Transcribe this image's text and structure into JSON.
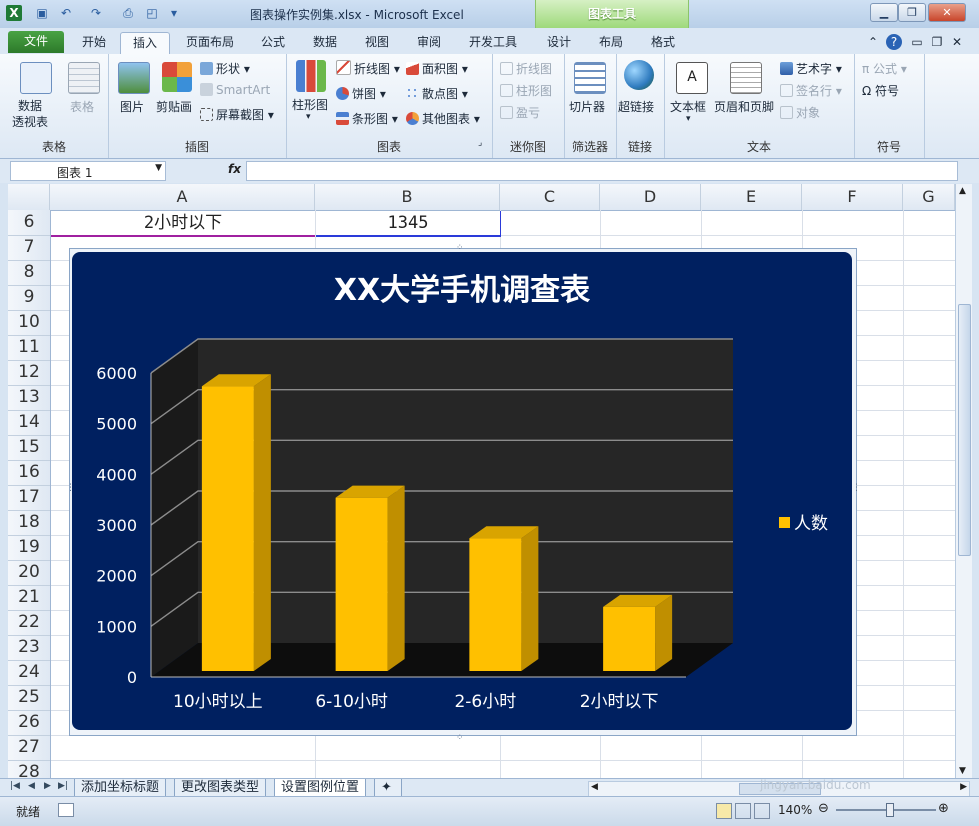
{
  "window": {
    "title": "图表操作实例集.xlsx  -  Microsoft Excel",
    "context_tab_group": "图表工具",
    "controls": [
      "minimize",
      "restore",
      "close"
    ]
  },
  "tabs": {
    "file": "文件",
    "items": [
      "开始",
      "插入",
      "页面布局",
      "公式",
      "数据",
      "视图",
      "审阅",
      "开发工具",
      "设计",
      "布局",
      "格式"
    ],
    "active": "插入"
  },
  "ribbon": {
    "tables": {
      "label": "表格",
      "pivot": "数据\n透视表",
      "table": "表格"
    },
    "illustrations": {
      "label": "插图",
      "picture": "图片",
      "clipart": "剪贴画",
      "shapes": "形状",
      "smartart": "SmartArt",
      "screenshot": "屏幕截图"
    },
    "charts": {
      "label": "图表",
      "column": "柱形图",
      "line": "折线图",
      "pie": "饼图",
      "bar": "条形图",
      "area": "面积图",
      "scatter": "散点图",
      "other": "其他图表"
    },
    "sparklines": {
      "label": "迷你图",
      "line": "折线图",
      "column": "柱形图",
      "winloss": "盈亏"
    },
    "filter": {
      "label": "筛选器",
      "slicer": "切片器"
    },
    "links": {
      "label": "链接",
      "hyperlink": "超链接"
    },
    "text": {
      "label": "文本",
      "textbox": "文本框",
      "header_footer": "页眉和页脚",
      "wordart": "艺术字",
      "signature": "签名行",
      "object": "对象"
    },
    "symbols": {
      "label": "符号",
      "equation": "公式",
      "symbol": "符号"
    }
  },
  "formula_bar": {
    "name_box": "图表 1",
    "fx": "fx",
    "value": ""
  },
  "grid": {
    "columns": [
      "A",
      "B",
      "C",
      "D",
      "E",
      "F",
      "G"
    ],
    "rows": [
      "6",
      "7",
      "8",
      "9",
      "10",
      "11",
      "12",
      "13",
      "14",
      "15",
      "16",
      "17",
      "18",
      "19",
      "20",
      "21",
      "22",
      "23",
      "24",
      "25",
      "26",
      "27",
      "28"
    ],
    "cells": {
      "A6": "2小时以下",
      "B6": "1345"
    }
  },
  "chart_data": {
    "type": "bar",
    "style": "3d-column",
    "title": "XX大学手机调查表",
    "categories": [
      "10小时以上",
      "6-10小时",
      "2-6小时",
      "2小时以下"
    ],
    "series": [
      {
        "name": "人数",
        "values": [
          5700,
          3500,
          2700,
          1345
        ]
      }
    ],
    "ylim": [
      0,
      6000
    ],
    "yticks": [
      "0",
      "1000",
      "2000",
      "3000",
      "4000",
      "5000",
      "6000"
    ],
    "grid": true,
    "legend_position": "right",
    "colors": {
      "background": "#002060",
      "plot_back": "#262626",
      "floor": "#0d0d0d",
      "bar": "#ffc000",
      "bar_side": "#c08f00",
      "bar_top": "#d9a400",
      "text": "#ffffff"
    }
  },
  "sheets": {
    "tabs": [
      "添加坐标标题",
      "更改图表类型",
      "设置图例位置"
    ],
    "active": "设置图例位置"
  },
  "status": {
    "ready": "就绪",
    "zoom": "140%"
  },
  "watermark": "jingyan.baidu.com"
}
